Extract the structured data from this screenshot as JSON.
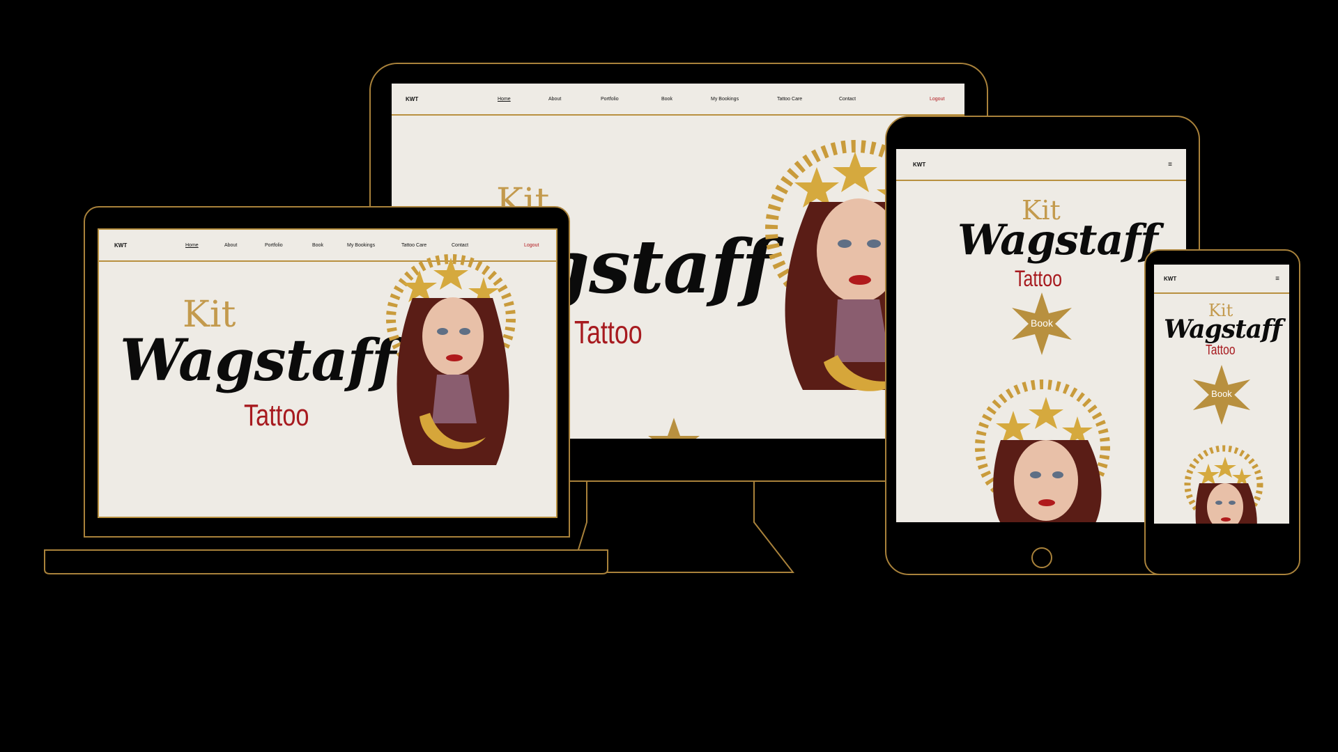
{
  "nav": {
    "brand": "KWT",
    "links": [
      "Home",
      "About",
      "Portfolio",
      "Book",
      "My Bookings",
      "Tattoo Care",
      "Contact"
    ],
    "logout": "Logout",
    "menu_icon": "≡"
  },
  "hero": {
    "kit": "Kit",
    "wagstaff": "Wagstaff",
    "tattoo": "Tattoo",
    "book": "Book",
    "desktop_visible_wag": "gstaff"
  },
  "colors": {
    "background": "#000000",
    "device_outline": "#a9823b",
    "screen_bg": "#eeebe5",
    "gold": "#c39a4d",
    "red": "#a71a1f",
    "logout": "#b0161c"
  }
}
